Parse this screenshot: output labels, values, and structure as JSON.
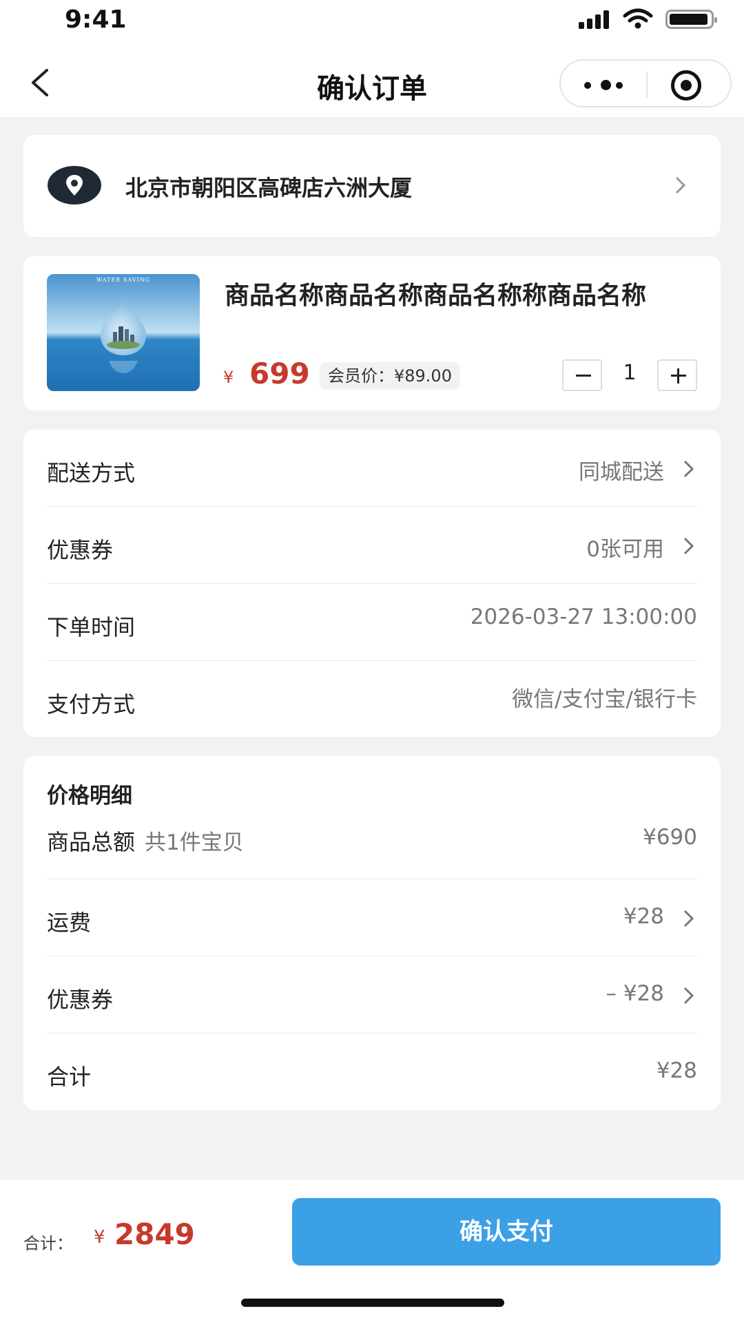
{
  "status_bar": {
    "time": "9:41"
  },
  "header": {
    "title": "确认订单"
  },
  "address": {
    "text": "北京市朝阳区高碑店六洲大厦"
  },
  "product": {
    "image_caption": "WATER SAVING",
    "name": "商品名称商品名称商品名称称商品名称",
    "currency": "¥",
    "price": "699",
    "member_price": "会员价：¥89.00",
    "quantity": "1"
  },
  "options": [
    {
      "label": "配送方式",
      "value": "同城配送"
    },
    {
      "label": "优惠券",
      "value": "0张可用"
    },
    {
      "label": "下单时间",
      "value": "2026-03-27  13:00:00"
    },
    {
      "label": "支付方式",
      "value": "微信/支付宝/银行卡"
    }
  ],
  "price_detail": {
    "title": "价格明细",
    "rows": [
      {
        "label": "商品总额",
        "sub": "共1件宝贝",
        "value": "¥690"
      },
      {
        "label": "运费",
        "value": "¥28"
      },
      {
        "label": "优惠券",
        "value": "– ¥28"
      },
      {
        "label": "合计",
        "value": "¥28"
      }
    ]
  },
  "footer": {
    "total_label": "合计：",
    "currency": "¥",
    "total_amount": "2849",
    "pay_button": "确认支付"
  },
  "colors": {
    "accent": "#3ba0e6",
    "price": "#c7392c",
    "background": "#f2f2f2"
  }
}
